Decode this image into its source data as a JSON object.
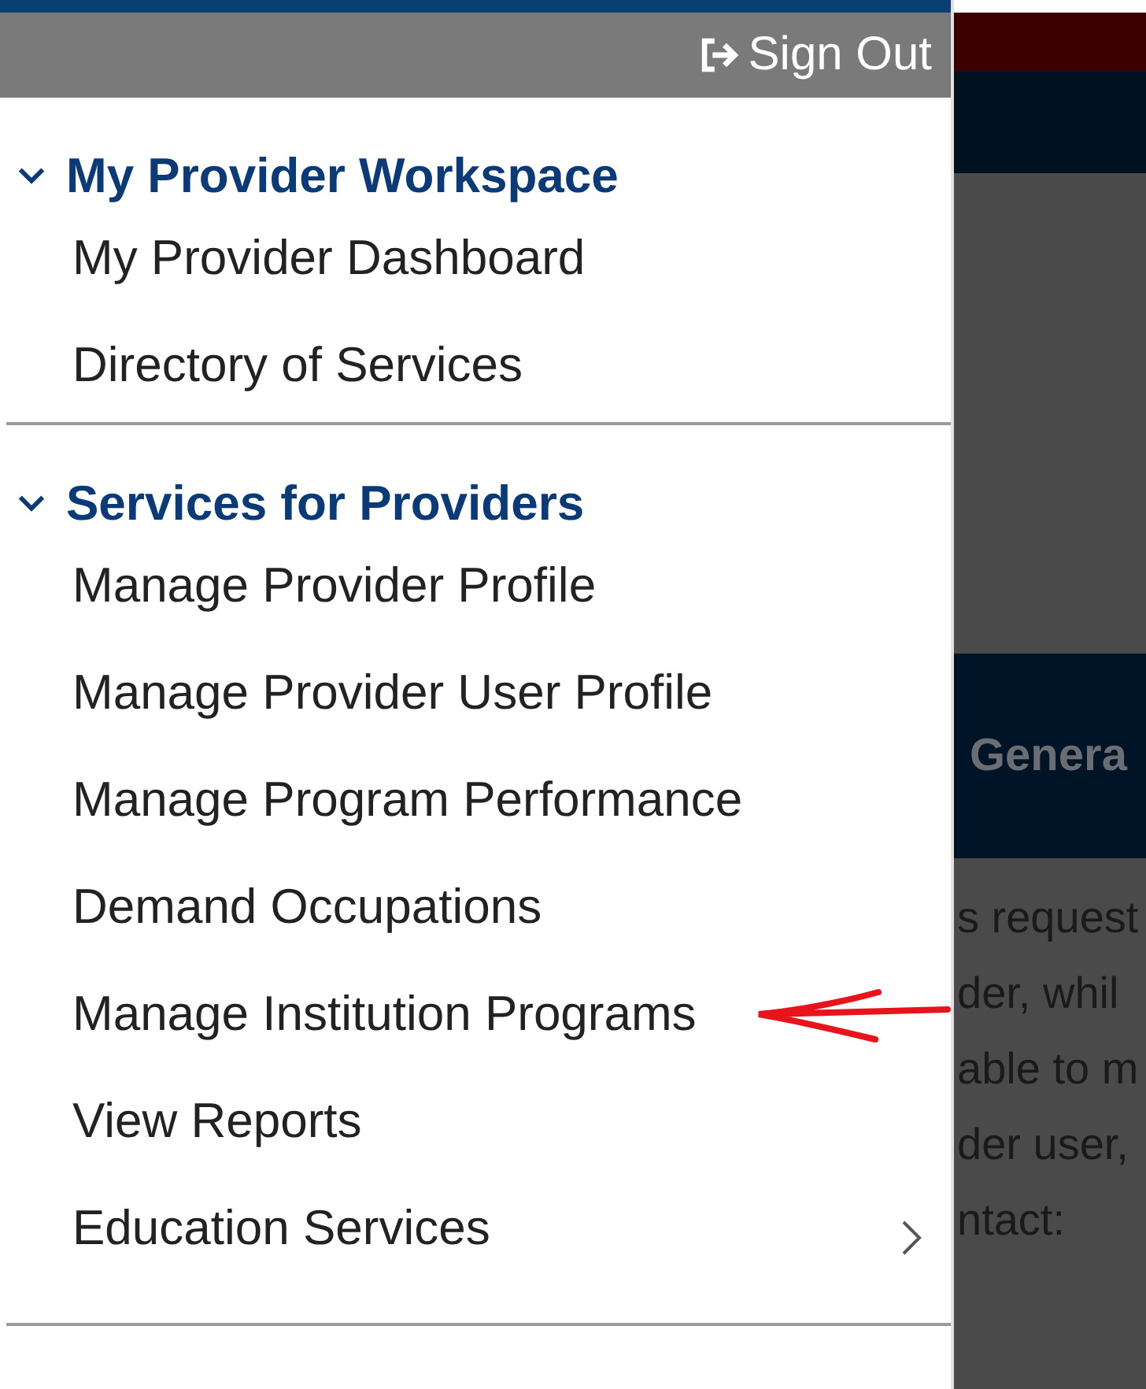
{
  "header": {
    "sign_out": "Sign Out"
  },
  "sections": [
    {
      "title": "My Provider Workspace",
      "expanded": true,
      "items": [
        {
          "label": "My Provider Dashboard",
          "has_submenu": false,
          "annotated": false
        },
        {
          "label": "Directory of Services",
          "has_submenu": false,
          "annotated": false
        }
      ]
    },
    {
      "title": "Services for Providers",
      "expanded": true,
      "items": [
        {
          "label": "Manage Provider Profile",
          "has_submenu": false,
          "annotated": false
        },
        {
          "label": "Manage Provider User Profile",
          "has_submenu": false,
          "annotated": false
        },
        {
          "label": "Manage Program Performance",
          "has_submenu": false,
          "annotated": false
        },
        {
          "label": "Demand Occupations",
          "has_submenu": false,
          "annotated": false
        },
        {
          "label": "Manage Institution Programs",
          "has_submenu": false,
          "annotated": true
        },
        {
          "label": "View Reports",
          "has_submenu": false,
          "annotated": false
        },
        {
          "label": "Education Services",
          "has_submenu": true,
          "annotated": false
        }
      ]
    }
  ],
  "background_page": {
    "banner_heading": "Genera",
    "lines": [
      "s request",
      "der, whil",
      "able to m",
      "der user,",
      "ntact:"
    ]
  }
}
